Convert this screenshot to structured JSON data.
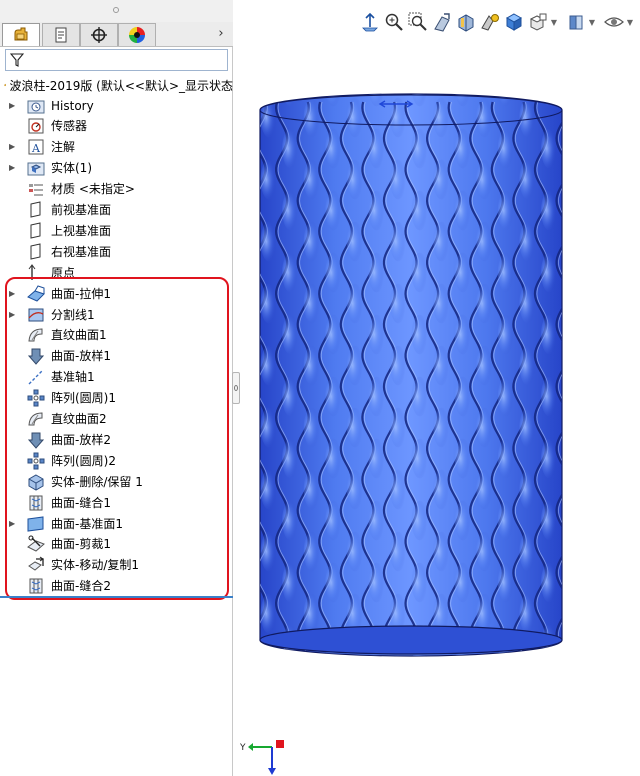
{
  "tree": {
    "root": "波浪柱-2019版 (默认<<默认>_显示状态",
    "items": [
      {
        "label": "History",
        "expandable": true,
        "icon": "history-folder"
      },
      {
        "label": "传感器",
        "expandable": false,
        "icon": "sensor"
      },
      {
        "label": "注解",
        "expandable": true,
        "icon": "annotation"
      },
      {
        "label": "实体(1)",
        "expandable": true,
        "icon": "solid-bodies-folder"
      },
      {
        "label": "材质 <未指定>",
        "expandable": false,
        "icon": "material"
      },
      {
        "label": "前视基准面",
        "expandable": false,
        "icon": "plane"
      },
      {
        "label": "上视基准面",
        "expandable": false,
        "icon": "plane"
      },
      {
        "label": "右视基准面",
        "expandable": false,
        "icon": "plane"
      },
      {
        "label": "原点",
        "expandable": false,
        "icon": "origin"
      },
      {
        "label": "曲面-拉伸1",
        "expandable": true,
        "icon": "surface-extrude"
      },
      {
        "label": "分割线1",
        "expandable": true,
        "icon": "split-line"
      },
      {
        "label": "直纹曲面1",
        "expandable": false,
        "icon": "ruled-surface"
      },
      {
        "label": "曲面-放样1",
        "expandable": false,
        "icon": "surface-loft"
      },
      {
        "label": "基准轴1",
        "expandable": false,
        "icon": "axis"
      },
      {
        "label": "阵列(圆周)1",
        "expandable": false,
        "icon": "circular-pattern"
      },
      {
        "label": "直纹曲面2",
        "expandable": false,
        "icon": "ruled-surface"
      },
      {
        "label": "曲面-放样2",
        "expandable": false,
        "icon": "surface-loft"
      },
      {
        "label": "阵列(圆周)2",
        "expandable": false,
        "icon": "circular-pattern"
      },
      {
        "label": "实体-删除/保留 1",
        "expandable": false,
        "icon": "delete-body"
      },
      {
        "label": "曲面-缝合1",
        "expandable": false,
        "icon": "surface-knit"
      },
      {
        "label": "曲面-基准面1",
        "expandable": true,
        "icon": "planar-surface"
      },
      {
        "label": "曲面-剪裁1",
        "expandable": false,
        "icon": "surface-trim"
      },
      {
        "label": "实体-移动/复制1",
        "expandable": false,
        "icon": "move-copy-body"
      },
      {
        "label": "曲面-缝合2",
        "expandable": false,
        "icon": "surface-knit"
      }
    ]
  },
  "tabs": [
    "feature-manager",
    "property-manager",
    "configuration-manager",
    "display-manager"
  ],
  "triad": {
    "y_label": "Y"
  },
  "colors": {
    "model_blue": "#3b63e6",
    "model_dark": "#1c35a8",
    "highlight_red": "#e0141e",
    "selection_blue": "#3a80c9"
  }
}
